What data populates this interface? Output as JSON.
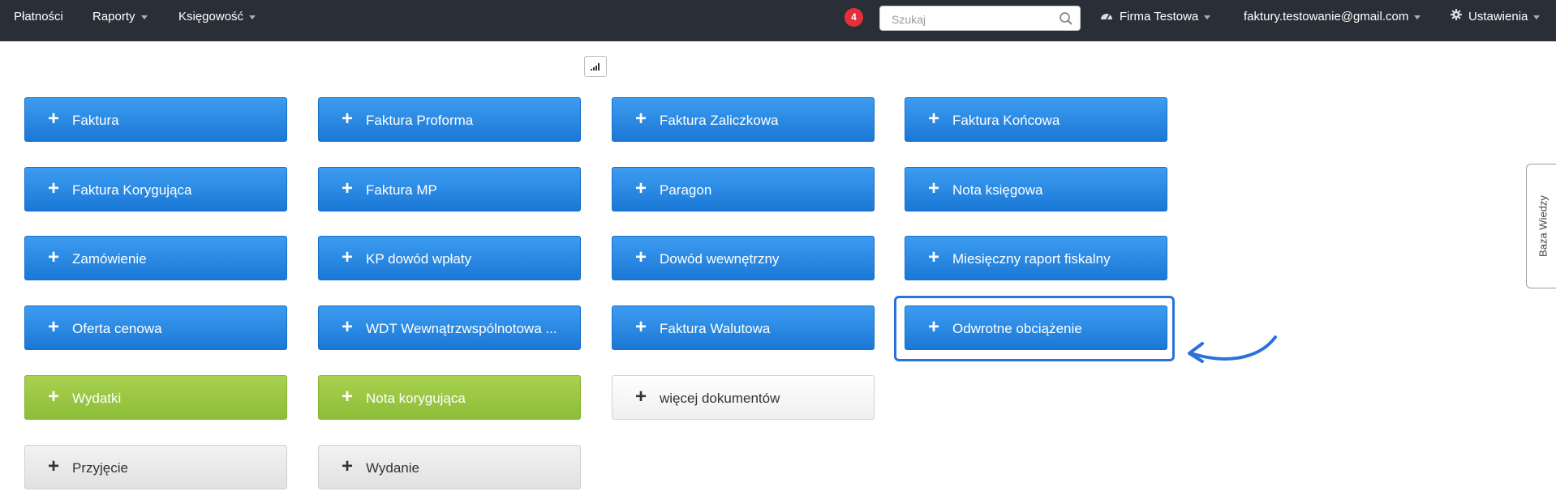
{
  "nav": {
    "payments": "Płatności",
    "reports": "Raporty",
    "accounting": "Księgowość",
    "notification_count": "4",
    "search_placeholder": "Szukaj",
    "company": "Firma Testowa",
    "user_email": "faktury.testowanie@gmail.com",
    "settings": "Ustawienia"
  },
  "documents": [
    {
      "label": "Faktura",
      "style": "blue"
    },
    {
      "label": "Faktura Proforma",
      "style": "blue"
    },
    {
      "label": "Faktura Zaliczkowa",
      "style": "blue"
    },
    {
      "label": "Faktura Końcowa",
      "style": "blue"
    },
    {
      "label": "Faktura Korygująca",
      "style": "blue"
    },
    {
      "label": "Faktura MP",
      "style": "blue"
    },
    {
      "label": "Paragon",
      "style": "blue"
    },
    {
      "label": "Nota księgowa",
      "style": "blue"
    },
    {
      "label": "Zamówienie",
      "style": "blue"
    },
    {
      "label": "KP dowód wpłaty",
      "style": "blue"
    },
    {
      "label": "Dowód wewnętrzny",
      "style": "blue"
    },
    {
      "label": "Miesięczny raport fiskalny",
      "style": "blue"
    },
    {
      "label": "Oferta cenowa",
      "style": "blue"
    },
    {
      "label": "WDT Wewnątrzwspólnotowa ...",
      "style": "blue"
    },
    {
      "label": "Faktura Walutowa",
      "style": "blue"
    },
    {
      "label": "Odwrotne obciążenie",
      "style": "blue"
    },
    {
      "label": "Wydatki",
      "style": "green"
    },
    {
      "label": "Nota korygująca",
      "style": "green"
    },
    {
      "label": "więcej dokumentów",
      "style": "light"
    },
    {
      "label": "Przyjęcie",
      "style": "grey"
    },
    {
      "label": "Wydanie",
      "style": "grey"
    }
  ],
  "plus_symbol": "+",
  "side_tab": "Baza Wiedzy",
  "colors": {
    "navbar": "#2a2f37",
    "blue_button": "#1f86e6",
    "green_button": "#9bc743",
    "highlight": "#2a72da",
    "badge": "#e5303b"
  }
}
